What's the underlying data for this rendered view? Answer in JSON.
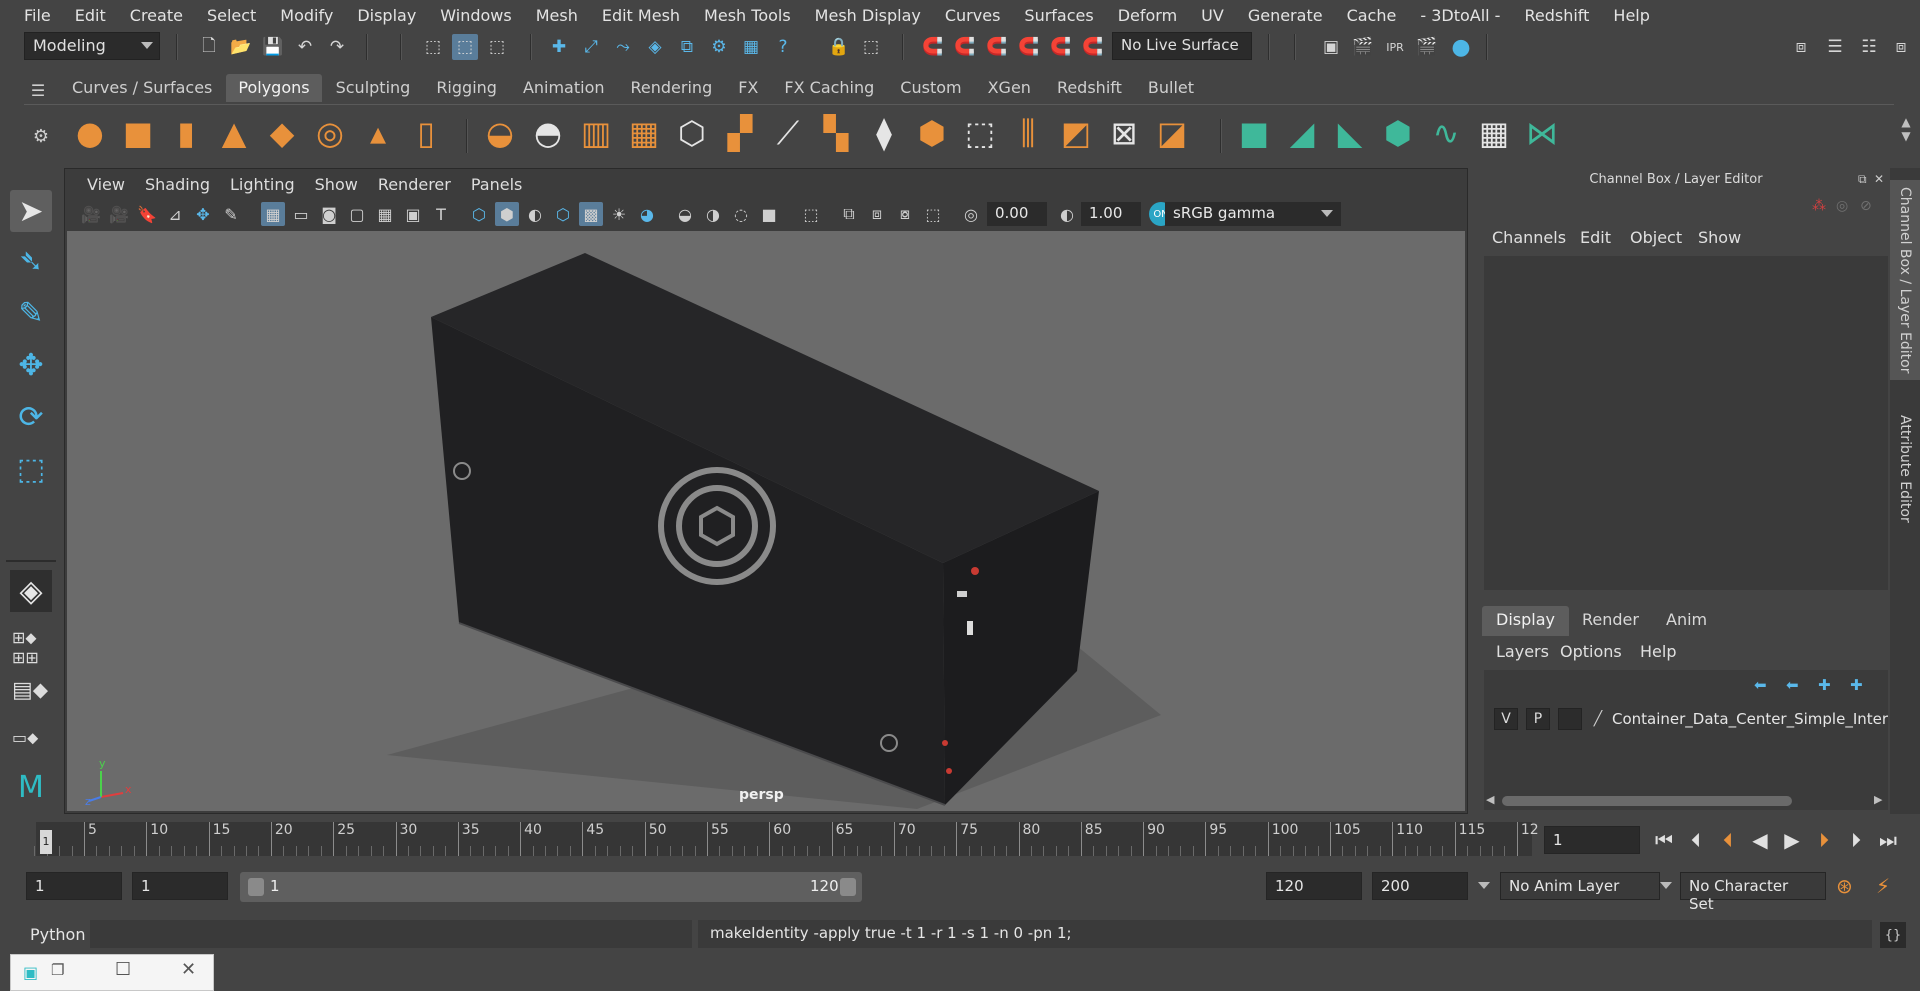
{
  "menubar": [
    "File",
    "Edit",
    "Create",
    "Select",
    "Modify",
    "Display",
    "Windows",
    "Mesh",
    "Edit Mesh",
    "Mesh Tools",
    "Mesh Display",
    "Curves",
    "Surfaces",
    "Deform",
    "UV",
    "Generate",
    "Cache",
    "- 3DtoAll -",
    "Redshift",
    "Help"
  ],
  "status": {
    "mode": "Modeling",
    "live_surface": "No Live Surface"
  },
  "shelf_tabs": [
    "Curves / Surfaces",
    "Polygons",
    "Sculpting",
    "Rigging",
    "Animation",
    "Rendering",
    "FX",
    "FX Caching",
    "Custom",
    "XGen",
    "Redshift",
    "Bullet"
  ],
  "shelf_active": "Polygons",
  "viewport": {
    "menu": [
      "View",
      "Shading",
      "Lighting",
      "Show",
      "Renderer",
      "Panels"
    ],
    "exposure": "0.00",
    "gamma": "1.00",
    "color_space": "sRGB gamma",
    "camera": "persp",
    "axis_x": "x",
    "axis_y": "y",
    "axis_z": "z"
  },
  "right_panel": {
    "title": "Channel Box / Layer Editor",
    "cb_menu": [
      "Channels",
      "Edit",
      "Object",
      "Show"
    ],
    "layer_tabs": [
      "Display",
      "Render",
      "Anim"
    ],
    "layer_menu": [
      "Layers",
      "Options",
      "Help"
    ],
    "layer": {
      "v": "V",
      "p": "P",
      "name": "Container_Data_Center_Simple_Interi"
    }
  },
  "side_tabs": [
    "Channel Box / Layer Editor",
    "Attribute Editor"
  ],
  "timeline": {
    "labels": [
      "5",
      "10",
      "15",
      "20",
      "25",
      "30",
      "35",
      "40",
      "45",
      "50",
      "55",
      "60",
      "65",
      "70",
      "75",
      "80",
      "85",
      "90",
      "95",
      "100",
      "105",
      "110",
      "115",
      "12"
    ],
    "current_marker": "1",
    "current_frame": "1"
  },
  "range": {
    "start": "1",
    "playback_start": "1",
    "handle_start": "1",
    "handle_end": "120",
    "playback_end": "120",
    "end": "200",
    "anim_layer": "No Anim Layer",
    "character_set": "No Character Set"
  },
  "command": {
    "lang": "Python",
    "result": "makeIdentity -apply true -t 1 -r 1 -s 1 -n 0 -pn 1;"
  }
}
